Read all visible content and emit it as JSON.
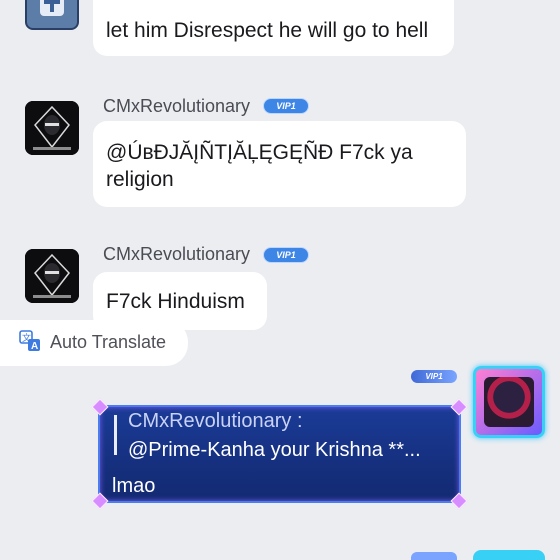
{
  "messages": [
    {
      "text": "let him Disrespect he will go to hell"
    },
    {
      "username": "CMxRevolutionary",
      "vip": "VIP1",
      "text_line1": "@ÚʙĐJĂĮÑTĮĂĻĘGĘÑĐ F7ck ya",
      "text_line2": "religion"
    },
    {
      "username": "CMxRevolutionary",
      "vip": "VIP1",
      "text": "F7ck Hinduism"
    }
  ],
  "translate": {
    "label": "Auto Translate",
    "icon": "translate-icon"
  },
  "my_message": {
    "vip": "VIP1",
    "quote_name": "CMxRevolutionary :",
    "quote_text": "@Prime-Kanha your Krishna **...",
    "reply": "lmao"
  },
  "colors": {
    "background": "#ebedf1",
    "bubble": "#ffffff",
    "vip_blue": "#3d86e6",
    "my_bubble": "#1a3b97"
  }
}
